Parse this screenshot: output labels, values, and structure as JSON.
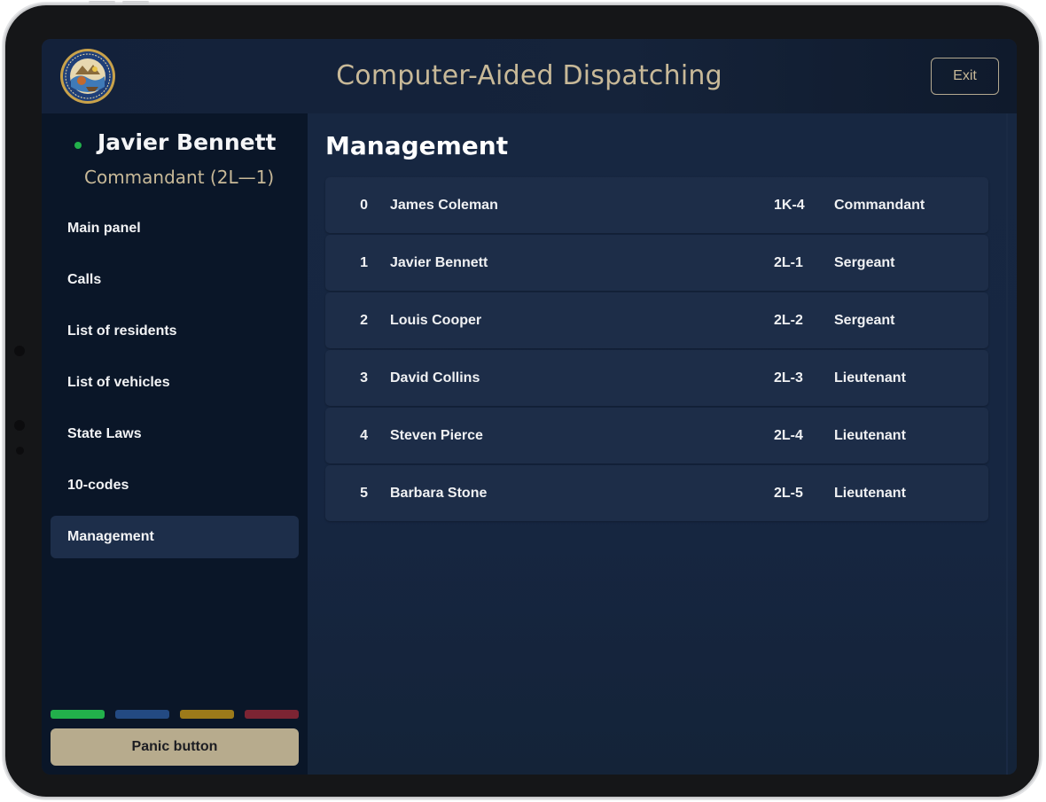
{
  "header": {
    "title": "Computer-Aided Dispatching",
    "exit_label": "Exit"
  },
  "user": {
    "name": "Javier Bennett",
    "rank": "Commandant (2L—1)"
  },
  "nav": {
    "items": [
      {
        "label": "Main panel"
      },
      {
        "label": "Calls"
      },
      {
        "label": "List of residents"
      },
      {
        "label": "List of vehicles"
      },
      {
        "label": "State Laws"
      },
      {
        "label": "10-codes"
      },
      {
        "label": "Management",
        "active": true
      }
    ]
  },
  "status_colors": [
    "#22b04b",
    "#234a82",
    "#9c7a1a",
    "#7c2433"
  ],
  "panic": {
    "label": "Panic button"
  },
  "main": {
    "title": "Management",
    "rows": [
      {
        "index": "0",
        "name": "James Coleman",
        "code": "1K-4",
        "rank": "Commandant"
      },
      {
        "index": "1",
        "name": "Javier Bennett",
        "code": "2L-1",
        "rank": "Sergeant"
      },
      {
        "index": "2",
        "name": "Louis Cooper",
        "code": "2L-2",
        "rank": "Sergeant"
      },
      {
        "index": "3",
        "name": "David Collins",
        "code": "2L-3",
        "rank": "Lieutenant"
      },
      {
        "index": "4",
        "name": "Steven Pierce",
        "code": "2L-4",
        "rank": "Lieutenant"
      },
      {
        "index": "5",
        "name": "Barbara Stone",
        "code": "2L-5",
        "rank": "Lieutenant"
      }
    ]
  }
}
